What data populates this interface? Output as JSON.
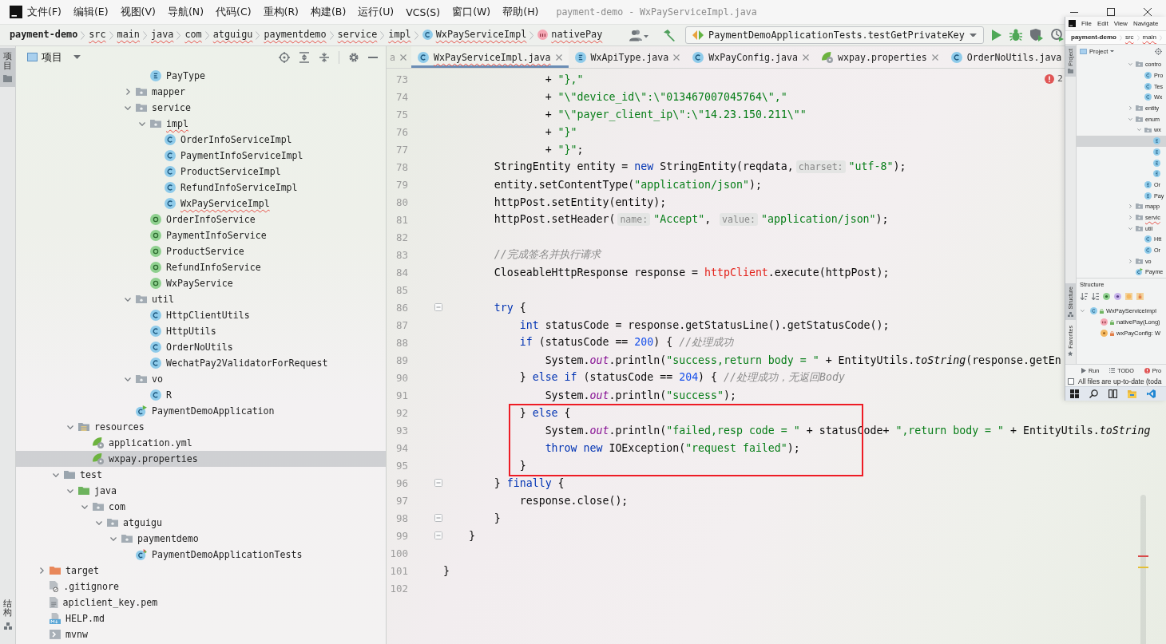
{
  "window": {
    "title": "payment-demo - WxPayServiceImpl.java"
  },
  "menu": [
    "文件(F)",
    "编辑(E)",
    "视图(V)",
    "导航(N)",
    "代码(C)",
    "重构(R)",
    "构建(B)",
    "运行(U)",
    "VCS(S)",
    "窗口(W)",
    "帮助(H)"
  ],
  "breadcrumb": [
    {
      "label": "payment-demo",
      "kind": "root",
      "wavy": false
    },
    {
      "label": "src",
      "kind": "folder",
      "wavy": true
    },
    {
      "label": "main",
      "kind": "folder",
      "wavy": true
    },
    {
      "label": "java",
      "kind": "folder",
      "wavy": true
    },
    {
      "label": "com",
      "kind": "folder",
      "wavy": true
    },
    {
      "label": "atguigu",
      "kind": "folder",
      "wavy": true
    },
    {
      "label": "paymentdemo",
      "kind": "folder",
      "wavy": true
    },
    {
      "label": "service",
      "kind": "folder",
      "wavy": true
    },
    {
      "label": "impl",
      "kind": "folder",
      "wavy": true
    },
    {
      "label": "WxPayServiceImpl",
      "kind": "class",
      "wavy": true
    },
    {
      "label": "nativePay",
      "kind": "method",
      "wavy": true
    }
  ],
  "run_config": {
    "label": "PaymentDemoApplicationTests.testGetPrivateKey"
  },
  "side_tabs": [
    {
      "label": "项目",
      "kind": "project",
      "selected": true
    },
    {
      "label": "结构",
      "kind": "structure",
      "selected": false
    }
  ],
  "project_panel": {
    "title": "项目",
    "tree": [
      {
        "children": [
          {
            "children": [
              {
                "children": [
                  {
                    "children": [
                      {
                        "children": [
                          {
                            "children": [
                              {
                                "children": [
                                  {
                                    "label": "PayType",
                                    "kind": "enum",
                                    "selected": false,
                                    "wavy": false
                                  }
                                ]
                              },
                              {
                                "label": "mapper",
                                "kind": "package",
                                "expanded": false,
                                "selected": false,
                                "wavy": false
                              },
                              {
                                "label": "service",
                                "kind": "package",
                                "expanded": true,
                                "selected": false,
                                "wavy": false,
                                "children": [
                                  {
                                    "label": "impl",
                                    "kind": "package",
                                    "expanded": true,
                                    "selected": false,
                                    "wavy": true,
                                    "children": [
                                      {
                                        "label": "OrderInfoServiceImpl",
                                        "kind": "class",
                                        "selected": false,
                                        "wavy": false
                                      },
                                      {
                                        "label": "PaymentInfoServiceImpl",
                                        "kind": "class",
                                        "selected": false,
                                        "wavy": false
                                      },
                                      {
                                        "label": "ProductServiceImpl",
                                        "kind": "class",
                                        "selected": false,
                                        "wavy": false
                                      },
                                      {
                                        "label": "RefundInfoServiceImpl",
                                        "kind": "class",
                                        "selected": false,
                                        "wavy": false
                                      },
                                      {
                                        "label": "WxPayServiceImpl",
                                        "kind": "class",
                                        "selected": false,
                                        "wavy": true
                                      }
                                    ]
                                  },
                                  {
                                    "label": "OrderInfoService",
                                    "kind": "interface",
                                    "selected": false,
                                    "wavy": false
                                  },
                                  {
                                    "label": "PaymentInfoService",
                                    "kind": "interface",
                                    "selected": false,
                                    "wavy": false
                                  },
                                  {
                                    "label": "ProductService",
                                    "kind": "interface",
                                    "selected": false,
                                    "wavy": false
                                  },
                                  {
                                    "label": "RefundInfoService",
                                    "kind": "interface",
                                    "selected": false,
                                    "wavy": false
                                  },
                                  {
                                    "label": "WxPayService",
                                    "kind": "interface",
                                    "selected": false,
                                    "wavy": false
                                  }
                                ]
                              },
                              {
                                "label": "util",
                                "kind": "package",
                                "expanded": true,
                                "selected": false,
                                "wavy": false,
                                "children": [
                                  {
                                    "label": "HttpClientUtils",
                                    "kind": "class",
                                    "selected": false,
                                    "wavy": false
                                  },
                                  {
                                    "label": "HttpUtils",
                                    "kind": "class",
                                    "selected": false,
                                    "wavy": false
                                  },
                                  {
                                    "label": "OrderNoUtils",
                                    "kind": "class",
                                    "selected": false,
                                    "wavy": false
                                  },
                                  {
                                    "label": "WechatPay2ValidatorForRequest",
                                    "kind": "class",
                                    "selected": false,
                                    "wavy": false
                                  }
                                ]
                              },
                              {
                                "label": "vo",
                                "kind": "package",
                                "expanded": true,
                                "selected": false,
                                "wavy": false,
                                "children": [
                                  {
                                    "label": "R",
                                    "kind": "class",
                                    "selected": false,
                                    "wavy": false
                                  }
                                ]
                              },
                              {
                                "label": "PaymentDemoApplication",
                                "kind": "spring-class",
                                "selected": false,
                                "wavy": false
                              }
                            ]
                          }
                        ]
                      }
                    ]
                  }
                ]
              },
              {
                "label": "resources",
                "kind": "resources-folder",
                "expanded": true,
                "selected": false,
                "wavy": false,
                "children": [
                  {
                    "label": "application.yml",
                    "kind": "spring-config",
                    "selected": false,
                    "wavy": false
                  },
                  {
                    "label": "wxpay.properties",
                    "kind": "spring-config",
                    "selected": true,
                    "wavy": false
                  }
                ]
              }
            ]
          },
          {
            "label": "test",
            "kind": "folder",
            "expanded": true,
            "selected": false,
            "wavy": false,
            "children": [
              {
                "label": "java",
                "kind": "test-root",
                "expanded": true,
                "selected": false,
                "wavy": false,
                "children": [
                  {
                    "label": "com",
                    "kind": "package",
                    "expanded": true,
                    "selected": false,
                    "wavy": false,
                    "children": [
                      {
                        "label": "atguigu",
                        "kind": "package",
                        "expanded": true,
                        "selected": false,
                        "wavy": false,
                        "children": [
                          {
                            "label": "paymentdemo",
                            "kind": "package",
                            "expanded": true,
                            "selected": false,
                            "wavy": false,
                            "children": [
                              {
                                "label": "PaymentDemoApplicationTests",
                                "kind": "test-class",
                                "selected": false,
                                "wavy": false
                              }
                            ]
                          }
                        ]
                      }
                    ]
                  }
                ]
              }
            ]
          }
        ]
      },
      {
        "label": "target",
        "kind": "excluded-folder",
        "expanded": false,
        "selected": false,
        "wavy": false
      },
      {
        "label": ".gitignore",
        "kind": "gitignore",
        "selected": false,
        "wavy": false
      },
      {
        "label": "apiclient_key.pem",
        "kind": "pem",
        "selected": false,
        "wavy": false
      },
      {
        "label": "HELP.md",
        "kind": "markdown",
        "selected": false,
        "wavy": false
      },
      {
        "label": "mvnw",
        "kind": "script",
        "selected": false,
        "wavy": false
      }
    ]
  },
  "editor": {
    "tabs": [
      {
        "label": "a",
        "kind": "plain",
        "selected": false,
        "wavy": false,
        "close_button": true
      },
      {
        "label": "WxPayServiceImpl.java",
        "kind": "class",
        "selected": true,
        "wavy": true,
        "close_button": true
      },
      {
        "label": "WxApiType.java",
        "kind": "enum",
        "selected": false,
        "wavy": false,
        "close_button": true
      },
      {
        "label": "WxPayConfig.java",
        "kind": "class",
        "selected": false,
        "wavy": false,
        "close_button": true
      },
      {
        "label": "wxpay.properties",
        "kind": "spring-config",
        "selected": false,
        "wavy": false,
        "close_button": true
      },
      {
        "label": "OrderNoUtils.java",
        "kind": "class",
        "selected": false,
        "wavy": false,
        "close_button": false
      }
    ],
    "problems": "2",
    "lines": [
      {
        "number": "73",
        "fold": false,
        "tokens": [
          {
            "text": "                + ",
            "kind": "plain"
          },
          {
            "text": "\"},\"",
            "kind": "string"
          }
        ]
      },
      {
        "number": "74",
        "fold": false,
        "tokens": [
          {
            "text": "                + ",
            "kind": "plain"
          },
          {
            "text": "\"\\\"device_id\\\":\\\"013467007045764\\\",\"",
            "kind": "string"
          }
        ]
      },
      {
        "number": "75",
        "fold": false,
        "tokens": [
          {
            "text": "                + ",
            "kind": "plain"
          },
          {
            "text": "\"\\\"payer_client_ip\\\":\\\"14.23.150.211\\\"\"",
            "kind": "string"
          }
        ]
      },
      {
        "number": "76",
        "fold": false,
        "tokens": [
          {
            "text": "                + ",
            "kind": "plain"
          },
          {
            "text": "\"}\"",
            "kind": "string"
          }
        ]
      },
      {
        "number": "77",
        "fold": false,
        "tokens": [
          {
            "text": "                + ",
            "kind": "plain"
          },
          {
            "text": "\"}\"",
            "kind": "string"
          },
          {
            "text": ";",
            "kind": "plain"
          }
        ]
      },
      {
        "number": "78",
        "fold": false,
        "tokens": [
          {
            "text": "        StringEntity entity = ",
            "kind": "plain"
          },
          {
            "text": "new",
            "kind": "keyword"
          },
          {
            "text": " StringEntity(reqdata,",
            "kind": "plain"
          },
          {
            "text": "charset:",
            "kind": "hint"
          },
          {
            "text": "\"utf-8\"",
            "kind": "string"
          },
          {
            "text": ");",
            "kind": "plain"
          }
        ]
      },
      {
        "number": "79",
        "fold": false,
        "tokens": [
          {
            "text": "        entity.setContentType(",
            "kind": "plain"
          },
          {
            "text": "\"application/json\"",
            "kind": "string"
          },
          {
            "text": ");",
            "kind": "plain"
          }
        ]
      },
      {
        "number": "80",
        "fold": false,
        "tokens": [
          {
            "text": "        httpPost.setEntity(entity);",
            "kind": "plain"
          }
        ]
      },
      {
        "number": "81",
        "fold": false,
        "tokens": [
          {
            "text": "        httpPost.setHeader(",
            "kind": "plain"
          },
          {
            "text": "name:",
            "kind": "hint"
          },
          {
            "text": "\"Accept\"",
            "kind": "string"
          },
          {
            "text": ", ",
            "kind": "plain"
          },
          {
            "text": "value:",
            "kind": "hint"
          },
          {
            "text": "\"application/json\"",
            "kind": "string"
          },
          {
            "text": ");",
            "kind": "plain"
          }
        ]
      },
      {
        "number": "82",
        "fold": false
      },
      {
        "number": "83",
        "fold": false,
        "tokens": [
          {
            "text": "        //完成签名并执行请求",
            "kind": "comment"
          }
        ]
      },
      {
        "number": "84",
        "fold": false,
        "tokens": [
          {
            "text": "        CloseableHttpResponse response = ",
            "kind": "plain"
          },
          {
            "text": "httpClient",
            "kind": "error"
          },
          {
            "text": ".execute(httpPost);",
            "kind": "plain"
          }
        ]
      },
      {
        "number": "85",
        "fold": false
      },
      {
        "number": "86",
        "fold": true,
        "tokens": [
          {
            "text": "        try",
            "kind": "keyword"
          },
          {
            "text": " {",
            "kind": "plain"
          }
        ]
      },
      {
        "number": "87",
        "fold": false,
        "tokens": [
          {
            "text": "            int",
            "kind": "keyword"
          },
          {
            "text": " statusCode = response.getStatusLine().getStatusCode();",
            "kind": "plain"
          }
        ]
      },
      {
        "number": "88",
        "fold": false,
        "tokens": [
          {
            "text": "            if",
            "kind": "keyword"
          },
          {
            "text": " (statusCode == ",
            "kind": "plain"
          },
          {
            "text": "200",
            "kind": "number"
          },
          {
            "text": ") { ",
            "kind": "plain"
          },
          {
            "text": "//处理成功",
            "kind": "comment"
          }
        ]
      },
      {
        "number": "89",
        "fold": false,
        "tokens": [
          {
            "text": "                System.",
            "kind": "plain"
          },
          {
            "text": "out",
            "kind": "field"
          },
          {
            "text": ".println(",
            "kind": "plain"
          },
          {
            "text": "\"success,return body = \"",
            "kind": "string"
          },
          {
            "text": " + EntityUtils.",
            "kind": "plain"
          },
          {
            "text": "toString",
            "kind": "italic"
          },
          {
            "text": "(response.getEn",
            "kind": "plain"
          }
        ]
      },
      {
        "number": "90",
        "fold": false,
        "tokens": [
          {
            "text": "            } ",
            "kind": "plain"
          },
          {
            "text": "else if",
            "kind": "keyword"
          },
          {
            "text": " (statusCode == ",
            "kind": "plain"
          },
          {
            "text": "204",
            "kind": "number"
          },
          {
            "text": ") { ",
            "kind": "plain"
          },
          {
            "text": "//处理成功，无返回Body",
            "kind": "comment"
          }
        ]
      },
      {
        "number": "91",
        "fold": false,
        "tokens": [
          {
            "text": "                System.",
            "kind": "plain"
          },
          {
            "text": "out",
            "kind": "field"
          },
          {
            "text": ".println(",
            "kind": "plain"
          },
          {
            "text": "\"success\"",
            "kind": "string"
          },
          {
            "text": ");",
            "kind": "plain"
          }
        ]
      },
      {
        "number": "92",
        "fold": false,
        "tokens": [
          {
            "text": "            } ",
            "kind": "plain"
          },
          {
            "text": "else",
            "kind": "keyword"
          },
          {
            "text": " {",
            "kind": "plain"
          }
        ]
      },
      {
        "number": "93",
        "fold": false,
        "tokens": [
          {
            "text": "                System.",
            "kind": "plain"
          },
          {
            "text": "out",
            "kind": "field"
          },
          {
            "text": ".println(",
            "kind": "plain"
          },
          {
            "text": "\"failed,resp code = \"",
            "kind": "string"
          },
          {
            "text": " + statusCode+ ",
            "kind": "plain"
          },
          {
            "text": "\",return body = \"",
            "kind": "string"
          },
          {
            "text": " + EntityUtils.",
            "kind": "plain"
          },
          {
            "text": "toString",
            "kind": "italic"
          }
        ]
      },
      {
        "number": "94",
        "fold": false,
        "tokens": [
          {
            "text": "                throw new",
            "kind": "keyword"
          },
          {
            "text": " IOException(",
            "kind": "plain"
          },
          {
            "text": "\"request failed\"",
            "kind": "string"
          },
          {
            "text": ");",
            "kind": "plain"
          }
        ]
      },
      {
        "number": "95",
        "fold": false,
        "tokens": [
          {
            "text": "            }",
            "kind": "plain"
          }
        ]
      },
      {
        "number": "96",
        "fold": true,
        "tokens": [
          {
            "text": "        } ",
            "kind": "plain"
          },
          {
            "text": "finally",
            "kind": "keyword"
          },
          {
            "text": " {",
            "kind": "plain"
          }
        ]
      },
      {
        "number": "97",
        "fold": false,
        "tokens": [
          {
            "text": "            response.close();",
            "kind": "plain"
          }
        ]
      },
      {
        "number": "98",
        "fold": true,
        "tokens": [
          {
            "text": "        }",
            "kind": "plain"
          }
        ]
      },
      {
        "number": "99",
        "fold": true,
        "tokens": [
          {
            "text": "    }",
            "kind": "plain"
          }
        ]
      },
      {
        "number": "100",
        "fold": false
      },
      {
        "number": "101",
        "fold": false,
        "tokens": [
          {
            "text": "}",
            "kind": "plain"
          }
        ]
      },
      {
        "number": "102",
        "fold": false
      }
    ],
    "annotations": [
      {
        "kind": "rectangle"
      }
    ]
  },
  "mini_window": {
    "menu": [
      "File",
      "Edit",
      "View",
      "Navigate"
    ],
    "breadcrumb": [
      {
        "label": "payment-demo",
        "kind": "root",
        "wavy": false
      },
      {
        "label": "src",
        "kind": "folder",
        "wavy": true
      },
      {
        "label": "main",
        "kind": "folder",
        "wavy": true
      }
    ],
    "side_tabs": [
      {
        "label": "Project",
        "kind": "project",
        "selected": true
      },
      {
        "label": "Structure",
        "kind": "structure",
        "selected": true
      },
      {
        "label": "Favorites",
        "kind": "favorites",
        "selected": false
      }
    ],
    "project": {
      "title": "Project",
      "tree": [
        {
          "label": "contro",
          "kind": "package",
          "expanded": true,
          "selected": false,
          "wavy": false,
          "children": [
            {
              "label": "Pro",
              "kind": "class",
              "selected": false,
              "wavy": false
            },
            {
              "label": "Tes",
              "kind": "class",
              "selected": false,
              "wavy": false
            },
            {
              "label": "Wx",
              "kind": "class",
              "selected": false,
              "wavy": false
            }
          ]
        },
        {
          "label": "entity",
          "kind": "package",
          "expanded": false,
          "selected": false,
          "wavy": false
        },
        {
          "label": "enum",
          "kind": "package",
          "expanded": true,
          "selected": false,
          "wavy": false,
          "children": [
            {
              "label": "wx",
              "kind": "package",
              "expanded": true,
              "selected": false,
              "wavy": false,
              "children": [
                {
                  "kind": "enum",
                  "selected": true
                },
                {
                  "kind": "enum",
                  "selected": false
                },
                {
                  "kind": "enum",
                  "selected": false
                },
                {
                  "kind": "enum",
                  "selected": false
                }
              ]
            },
            {
              "label": "Or",
              "kind": "enum",
              "selected": false,
              "wavy": false
            },
            {
              "label": "Pay",
              "kind": "enum",
              "selected": false,
              "wavy": false
            }
          ]
        },
        {
          "label": "mapp",
          "kind": "package",
          "expanded": false,
          "selected": false,
          "wavy": false
        },
        {
          "label": "servic",
          "kind": "package",
          "expanded": false,
          "selected": false,
          "wavy": true
        },
        {
          "label": "util",
          "kind": "package",
          "expanded": true,
          "selected": false,
          "wavy": false,
          "children": [
            {
              "label": "Htt",
              "kind": "class",
              "selected": false,
              "wavy": false
            },
            {
              "label": "Or",
              "kind": "class",
              "selected": false,
              "wavy": false
            }
          ]
        },
        {
          "label": "vo",
          "kind": "package",
          "expanded": false,
          "selected": false,
          "wavy": false
        },
        {
          "label": "Payme",
          "kind": "spring-class",
          "selected": false,
          "wavy": false
        }
      ]
    },
    "structure": {
      "title": "Structure",
      "tree": [
        {
          "label": "WxPayServiceImpl",
          "kind": "class",
          "private": false,
          "expanded": true,
          "children": [
            {
              "label": "nativePay(Long)",
              "kind": "method",
              "private": false
            },
            {
              "label": "wxPayConfig: W",
              "kind": "field",
              "private": true
            }
          ]
        }
      ]
    },
    "tool_tabs": [
      {
        "label": "Run",
        "kind": "run"
      },
      {
        "label": "TODO",
        "kind": "todo"
      },
      {
        "label": "Pro",
        "kind": "problems"
      }
    ],
    "status": "All files are up-to-date (toda"
  }
}
